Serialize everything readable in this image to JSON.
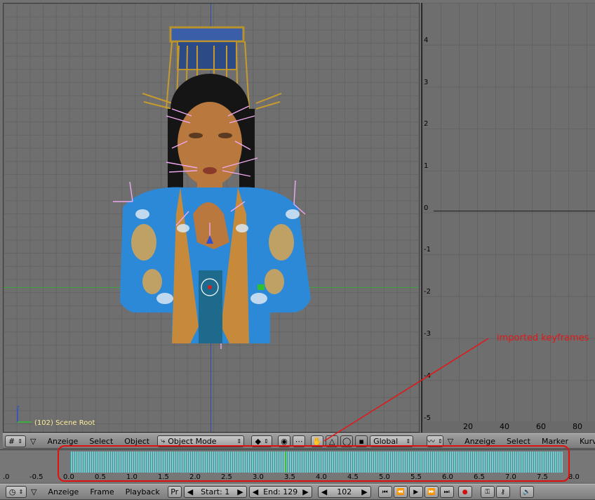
{
  "viewport": {
    "scene_label": "(102) Scene Root",
    "header": {
      "menus": [
        "Anzeige",
        "Select",
        "Object"
      ],
      "mode": "Object Mode",
      "orientation": "Global"
    }
  },
  "ipo": {
    "y_labels": [
      "4",
      "3",
      "2",
      "1",
      "0",
      "-1",
      "-2",
      "-3",
      "-4",
      "-5"
    ],
    "x_labels": [
      "20",
      "40",
      "60",
      "80"
    ],
    "header": {
      "menus": [
        "Anzeige",
        "Select",
        "Marker",
        "Kurv"
      ]
    }
  },
  "timeline": {
    "ticks": [
      ".0",
      "-0.5",
      "0.0",
      "0.5",
      "1.0",
      "1.5",
      "2.0",
      "2.5",
      "3.0",
      "3.5",
      "4.0",
      "4.5",
      "5.0",
      "5.5",
      "6.0",
      "6.5",
      "7.0",
      "7.5",
      "8.0"
    ],
    "header": {
      "menus": [
        "Anzeige",
        "Frame",
        "Playback"
      ],
      "pr_label": "Pr",
      "start": "Start: 1",
      "end": "End: 129",
      "current_frame": "102"
    }
  },
  "annotation": {
    "text": "imported keyframes",
    "color": "#e01818"
  }
}
